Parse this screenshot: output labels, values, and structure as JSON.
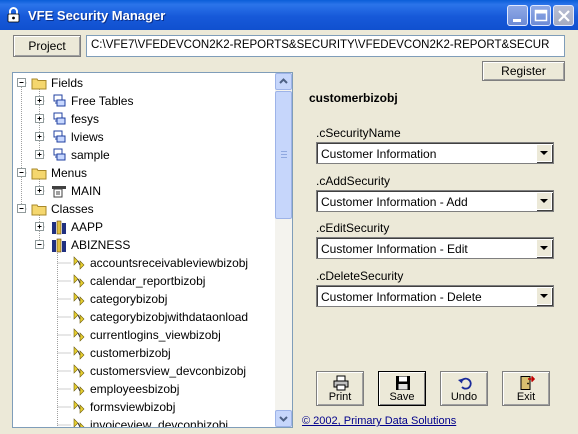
{
  "window": {
    "title": "VFE Security Manager",
    "accent": "#1759D9"
  },
  "toolbar": {
    "project_label": "Project",
    "project_path": "C:\\VFE7\\VFEDEVCON2K2-REPORTS&SECURITY\\VFEDEVCON2K2-REPORT&SECUR",
    "register_label": "Register"
  },
  "tree": {
    "groups": {
      "fields": "Fields",
      "menus": "Menus",
      "classes": "Classes"
    },
    "fields_items": [
      "Free Tables",
      "fesys",
      "lviews",
      "sample"
    ],
    "menus_items": [
      "MAIN"
    ],
    "class_libs": [
      "AAPP",
      "ABIZNESS"
    ],
    "abizness_items": [
      "accountsreceivableviewbizobj",
      "calendar_reportbizobj",
      "categorybizobj",
      "categorybizobjwithdataonload",
      "currentlogins_viewbizobj",
      "customerbizobj",
      "customersview_devconbizobj",
      "employeesbizobj",
      "formsviewbizobj",
      "invoiceview_devconbizobj"
    ]
  },
  "detail": {
    "object_name": "customerbizobj",
    "fields": [
      {
        "label": ".cSecurityName",
        "value": "Customer Information"
      },
      {
        "label": ".cAddSecurity",
        "value": "Customer Information - Add"
      },
      {
        "label": ".cEditSecurity",
        "value": "Customer Information - Edit"
      },
      {
        "label": ".cDeleteSecurity",
        "value": "Customer Information - Delete"
      }
    ]
  },
  "actions": {
    "print": "Print",
    "save": "Save",
    "undo": "Undo",
    "exit": "Exit"
  },
  "footer": {
    "copyright": "© 2002, Primary Data Solutions"
  }
}
